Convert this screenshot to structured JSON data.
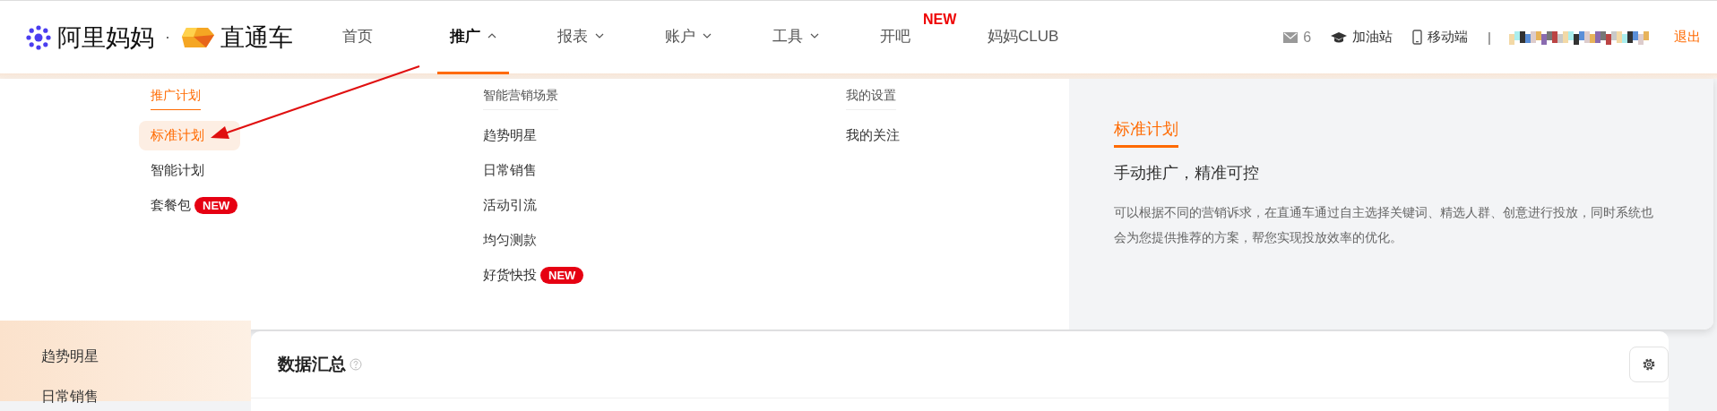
{
  "header": {
    "logo": {
      "brand": "阿里妈妈",
      "separator": "·",
      "product": "直通车"
    },
    "nav": [
      {
        "label": "首页",
        "selected": false,
        "has_dropdown": false
      },
      {
        "label": "推广",
        "selected": true,
        "has_dropdown": true
      },
      {
        "label": "报表",
        "selected": false,
        "has_dropdown": true
      },
      {
        "label": "账户",
        "selected": false,
        "has_dropdown": true
      },
      {
        "label": "工具",
        "selected": false,
        "has_dropdown": true
      },
      {
        "label": "开吧",
        "selected": false,
        "has_dropdown": false,
        "badge": "NEW"
      },
      {
        "label": "妈妈CLUB",
        "selected": false,
        "has_dropdown": false
      }
    ],
    "messages": "6",
    "links": [
      {
        "kind": "cap",
        "label": "加油站"
      },
      {
        "kind": "phone",
        "label": "移动端"
      }
    ],
    "separator": "|",
    "logout": "退出"
  },
  "dropdown": {
    "columns": [
      {
        "heading": "推广计划",
        "selected": true,
        "items": [
          {
            "label": "标准计划",
            "selected": true
          },
          {
            "label": "智能计划",
            "selected": false
          },
          {
            "label": "套餐包",
            "selected": false,
            "badge": "NEW"
          }
        ]
      },
      {
        "heading": "智能营销场景",
        "selected": false,
        "items": [
          {
            "label": "趋势明星",
            "selected": false
          },
          {
            "label": "日常销售",
            "selected": false
          },
          {
            "label": "活动引流",
            "selected": false
          },
          {
            "label": "均匀测款",
            "selected": false
          },
          {
            "label": "好货快投",
            "selected": false,
            "badge": "NEW"
          }
        ]
      },
      {
        "heading": "我的设置",
        "selected": false,
        "items": [
          {
            "label": "我的关注",
            "selected": false
          }
        ]
      }
    ],
    "detail": {
      "title": "标准计划",
      "subtitle": "手动推广，精准可控",
      "description": "可以根据不同的营销诉求，在直通车通过自主选择关键词、精选人群、创意进行投放，同时系统也会为您提供推荐的方案，帮您实现投放效率的优化。"
    }
  },
  "sidebar": {
    "items": [
      {
        "label": "趋势明星"
      },
      {
        "label": "日常销售"
      }
    ]
  },
  "card": {
    "title": "数据汇总"
  }
}
